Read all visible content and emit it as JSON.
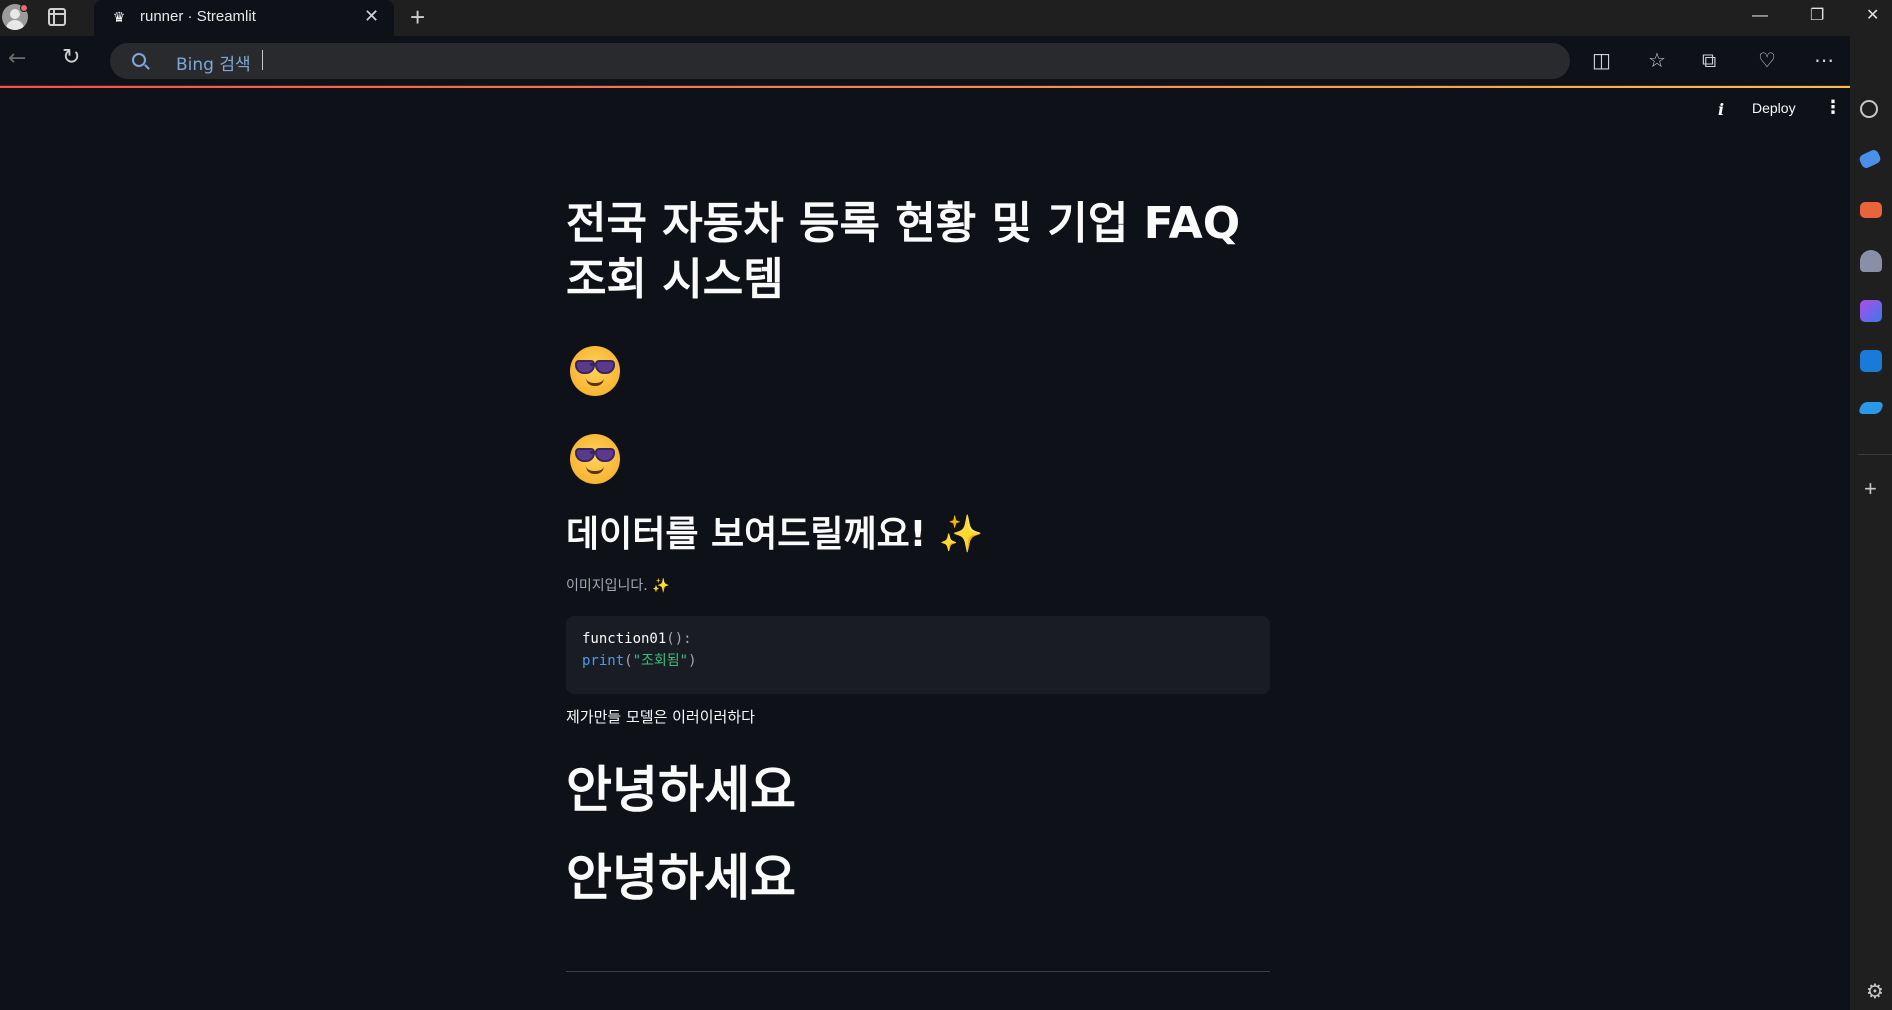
{
  "browser": {
    "tab_title": "runner · Streamlit",
    "tab_close": "✕",
    "new_tab": "+",
    "address_placeholder": "Bing 검색",
    "window_controls": {
      "minimize": "—",
      "restore": "❐",
      "close": "✕"
    }
  },
  "toolbar_icons": [
    "split-screen-icon",
    "favorites-icon",
    "collections-icon",
    "browser-essentials-icon",
    "more-icon"
  ],
  "app_header": {
    "info_label": "i",
    "deploy_label": "Deploy",
    "menu_label": "⋮"
  },
  "main": {
    "title": "전국 자동차 등록 현황 및 기업 FAQ 조회 시스템",
    "subheader": "데이터를 보여드릴께요! ✨",
    "caption": "이미지입니다. ✨",
    "code": {
      "line1_fn": "function01",
      "line1_punc": "():",
      "line2_kw": "print",
      "line2_open": "(",
      "line2_str": "\"조회됨\"",
      "line2_close": ")"
    },
    "paragraph": "제가만들  모델은  이러이러하다",
    "heading_1": "안녕하세요",
    "heading_2": "안녕하세요"
  },
  "colors": {
    "app_bg": "#0e1117",
    "text": "#fafafa",
    "code_bg": "#1a1c24",
    "accent_gradient_start": "#ff4b4b",
    "accent_gradient_end": "#ffbd45"
  }
}
